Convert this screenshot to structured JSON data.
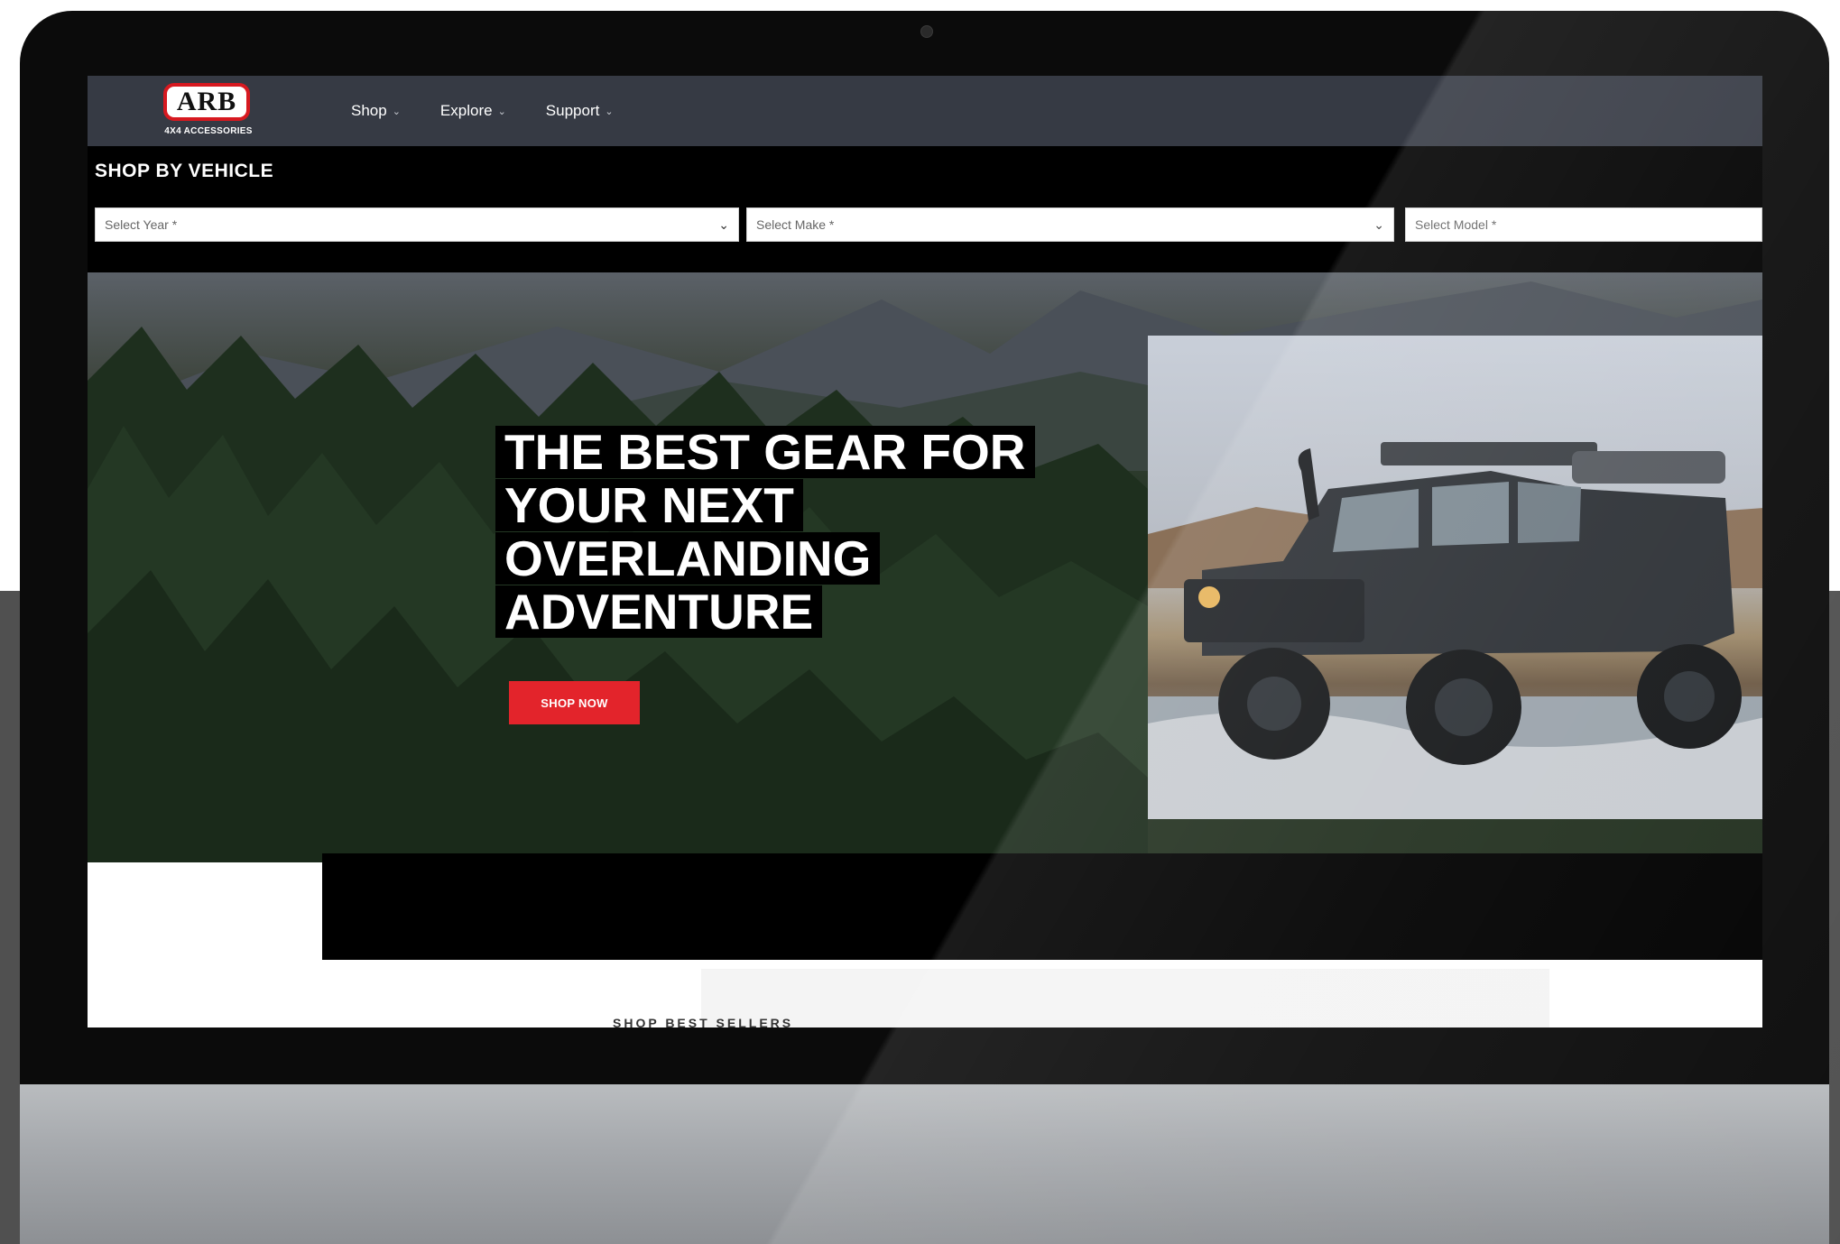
{
  "brand": {
    "logo_text": "ARB",
    "logo_sub": "4X4 ACCESSORIES"
  },
  "nav": {
    "items": [
      {
        "label": "Shop"
      },
      {
        "label": "Explore"
      },
      {
        "label": "Support"
      }
    ]
  },
  "shop_by_vehicle": {
    "title": "SHOP BY VEHICLE",
    "year_placeholder": "Select Year *",
    "make_placeholder": "Select Make *",
    "model_placeholder": "Select Model *"
  },
  "hero": {
    "title_lines": [
      "THE BEST GEAR FOR",
      "YOUR NEXT",
      "OVERLANDING",
      "ADVENTURE"
    ],
    "cta": "SHOP NOW"
  },
  "sections": {
    "best_sellers": "SHOP BEST SELLERS"
  },
  "colors": {
    "accent": "#e3242b",
    "nav_bg": "#363a44",
    "logo_red": "#d71920"
  },
  "icons": {
    "nav_chevron": "chevron-down-icon",
    "select_caret": "caret-down-icon"
  }
}
